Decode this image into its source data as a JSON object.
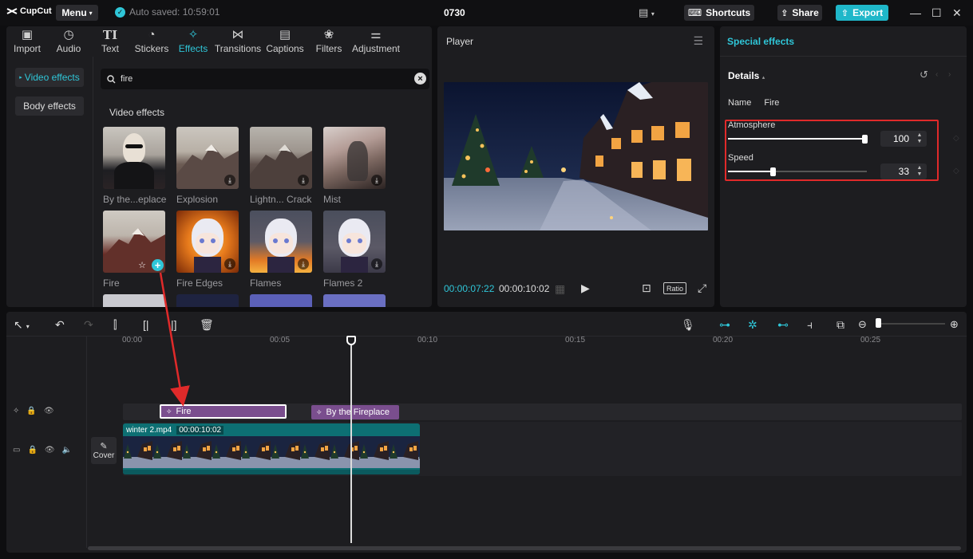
{
  "app": {
    "logo_text": "CupCut",
    "menu_label": "Menu",
    "autosave_text": "Auto saved: 10:59:01",
    "project_title": "0730"
  },
  "topbar": {
    "shortcuts_label": "Shortcuts",
    "share_label": "Share",
    "export_label": "Export"
  },
  "tabs": [
    {
      "label": "Import",
      "icon": "import-icon"
    },
    {
      "label": "Audio",
      "icon": "audio-icon"
    },
    {
      "label": "Text",
      "icon": "text-icon"
    },
    {
      "label": "Stickers",
      "icon": "stickers-icon"
    },
    {
      "label": "Effects",
      "icon": "effects-icon"
    },
    {
      "label": "Transitions",
      "icon": "transitions-icon"
    },
    {
      "label": "Captions",
      "icon": "captions-icon"
    },
    {
      "label": "Filters",
      "icon": "filters-icon"
    },
    {
      "label": "Adjustment",
      "icon": "adjustment-icon"
    }
  ],
  "sidebar": {
    "video_effects": "Video effects",
    "body_effects": "Body effects"
  },
  "search": {
    "value": "fire"
  },
  "effects_section_title": "Video effects",
  "effects": [
    {
      "label": "By the...eplace"
    },
    {
      "label": "Explosion"
    },
    {
      "label": "Lightn... Crack"
    },
    {
      "label": "Mist"
    },
    {
      "label": "Fire"
    },
    {
      "label": "Fire Edges"
    },
    {
      "label": "Flames"
    },
    {
      "label": "Flames 2"
    }
  ],
  "player": {
    "title": "Player",
    "current_time": "00:00:07:22",
    "total_time": "00:00:10:02",
    "ratio_label": "Ratio"
  },
  "props": {
    "title": "Special effects",
    "details_label": "Details",
    "name_label": "Name",
    "name_value": "Fire",
    "params": [
      {
        "label": "Atmosphere",
        "value": "100",
        "level": 1.0
      },
      {
        "label": "Speed",
        "value": "33",
        "level": 0.33
      }
    ]
  },
  "timeline": {
    "ticks": [
      "00:00",
      "00:05",
      "00:10",
      "00:15",
      "00:20",
      "00:25"
    ],
    "fx_clips": [
      {
        "label": "Fire"
      },
      {
        "label": "By the Fireplace"
      }
    ],
    "video_clip": {
      "name": "winter 2.mp4",
      "duration": "00:00:10:02"
    },
    "cover_label": "Cover"
  },
  "colors": {
    "accent": "#2fc6d8",
    "highlight_box": "#e02a2a",
    "fx_clip": "#7a4e8e",
    "video_clip": "#0d6f73"
  }
}
